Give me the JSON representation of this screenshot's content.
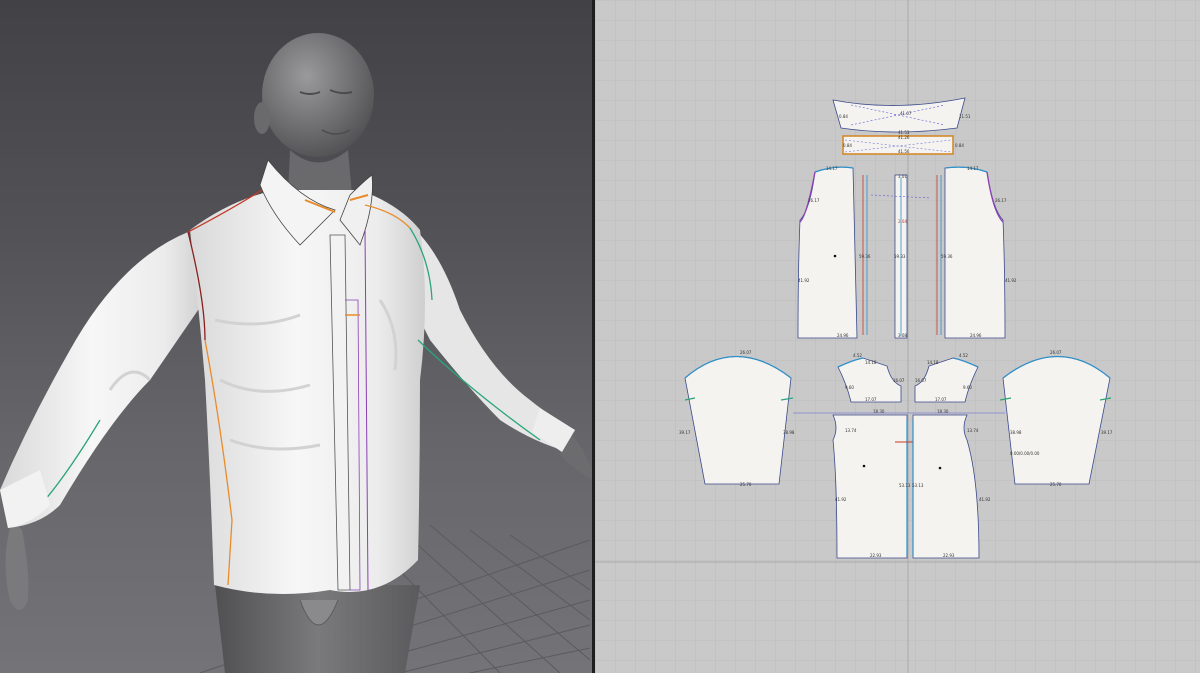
{
  "views": {
    "viewport_3d": "3d-avatar-view",
    "viewport_2d": "2d-pattern-view"
  },
  "colors": {
    "panel_fill": "#f4f3ef",
    "panel_outline": "#3a4a8c",
    "seam_blue": "#2f8fc9",
    "seam_teal": "#2aa57a",
    "seam_orange": "#e98b2a",
    "seam_red": "#c23b2a",
    "seam_purple": "#8b3fb5",
    "grid_bg": "#c9c9c9"
  },
  "measurements": {
    "collar_top": "41.07",
    "collar_side_l": "0.84",
    "collar_side_r": "11.51",
    "stand_top": "41.53",
    "stand_mid": "41.26",
    "stand_bottom": "41.56",
    "stand_l": "0.84",
    "stand_r": "0.84",
    "front_shoulder_l": "14.17",
    "front_shoulder_r": "14.17",
    "front_armhole_l": "26.17",
    "front_armhole_r": "26.17",
    "front_side_l": "41.92",
    "front_side_r": "41.92",
    "front_hem_l": "24.96",
    "front_hem_r": "24.96",
    "center_front_l": "59.36",
    "center_front_r": "59.36",
    "placket_len": "59.33",
    "placket_len2": "59.37",
    "placket_top": "3.01",
    "placket_bottom": "3.08",
    "placket_mark": "2.04",
    "sleeve_cap_l": "26.07",
    "sleeve_cap_r": "26.07",
    "sleeve_side_l": "39.17",
    "sleeve_side_r": "39.17",
    "sleeve_seam_l": "38.98",
    "sleeve_seam_r": "38.98",
    "sleeve_cuff_l": "25.70",
    "sleeve_cuff_r": "25.70",
    "sleeve_pleat": "0.00/0.00/0.00",
    "yoke_top_l": "4.52",
    "yoke_top_r": "4.52",
    "yoke_shoulder_l": "14.18",
    "yoke_shoulder_r": "14.18",
    "yoke_side_l": "9.60",
    "yoke_side_r": "9.60",
    "yoke_bottom_l": "17.07",
    "yoke_bottom_r": "17.07",
    "yoke_center_l": "16.07",
    "yoke_center_r": "16.07",
    "back_top_l": "18.30",
    "back_top_r": "18.30",
    "back_armhole_l": "13.74",
    "back_armhole_r": "13.74",
    "back_side_l": "41.92",
    "back_side_r": "41.92",
    "back_center_l": "53.13",
    "back_center_r": "53.13",
    "back_hem_l": "22.93",
    "back_hem_r": "22.93"
  }
}
